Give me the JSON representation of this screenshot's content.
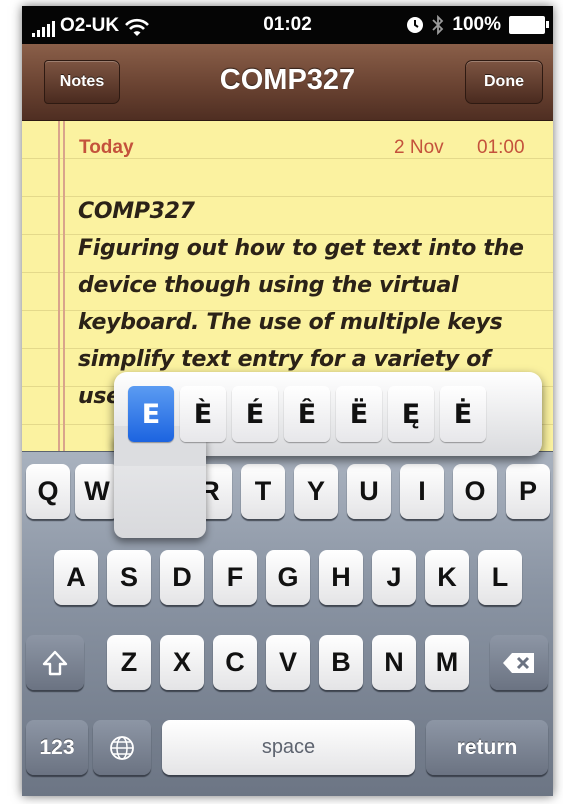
{
  "status_bar": {
    "carrier": "O2-UK",
    "time": "01:02",
    "battery": "100%"
  },
  "nav": {
    "back_label": "Notes",
    "title": "COMP327",
    "done_label": "Done"
  },
  "note": {
    "day": "Today",
    "date": "2 Nov",
    "time": "01:00",
    "lines": [
      "COMP327",
      "Figuring out how to get text into the",
      "device though using the virtual",
      "keyboard. The use of multiple keys",
      "simplify text entry for a variety of",
      "use"
    ]
  },
  "accent_popup": {
    "options": [
      "E",
      "È",
      "É",
      "Ê",
      "Ë",
      "Ę",
      "Ė"
    ],
    "selected": "E"
  },
  "keyboard": {
    "row1_left": [
      "Q",
      "W"
    ],
    "row1_right": [
      "R",
      "T",
      "Y",
      "U",
      "I",
      "O",
      "P"
    ],
    "row2": [
      "A",
      "S",
      "D",
      "F",
      "G",
      "H",
      "J",
      "K",
      "L"
    ],
    "row3": [
      "Z",
      "X",
      "C",
      "V",
      "B",
      "N",
      "M"
    ],
    "numbers_label": "123",
    "space_label": "space",
    "return_label": "return"
  },
  "icons": [
    "wifi-icon",
    "alarm-icon",
    "bluetooth-icon",
    "battery-icon",
    "shift-icon",
    "delete-icon",
    "globe-icon"
  ]
}
